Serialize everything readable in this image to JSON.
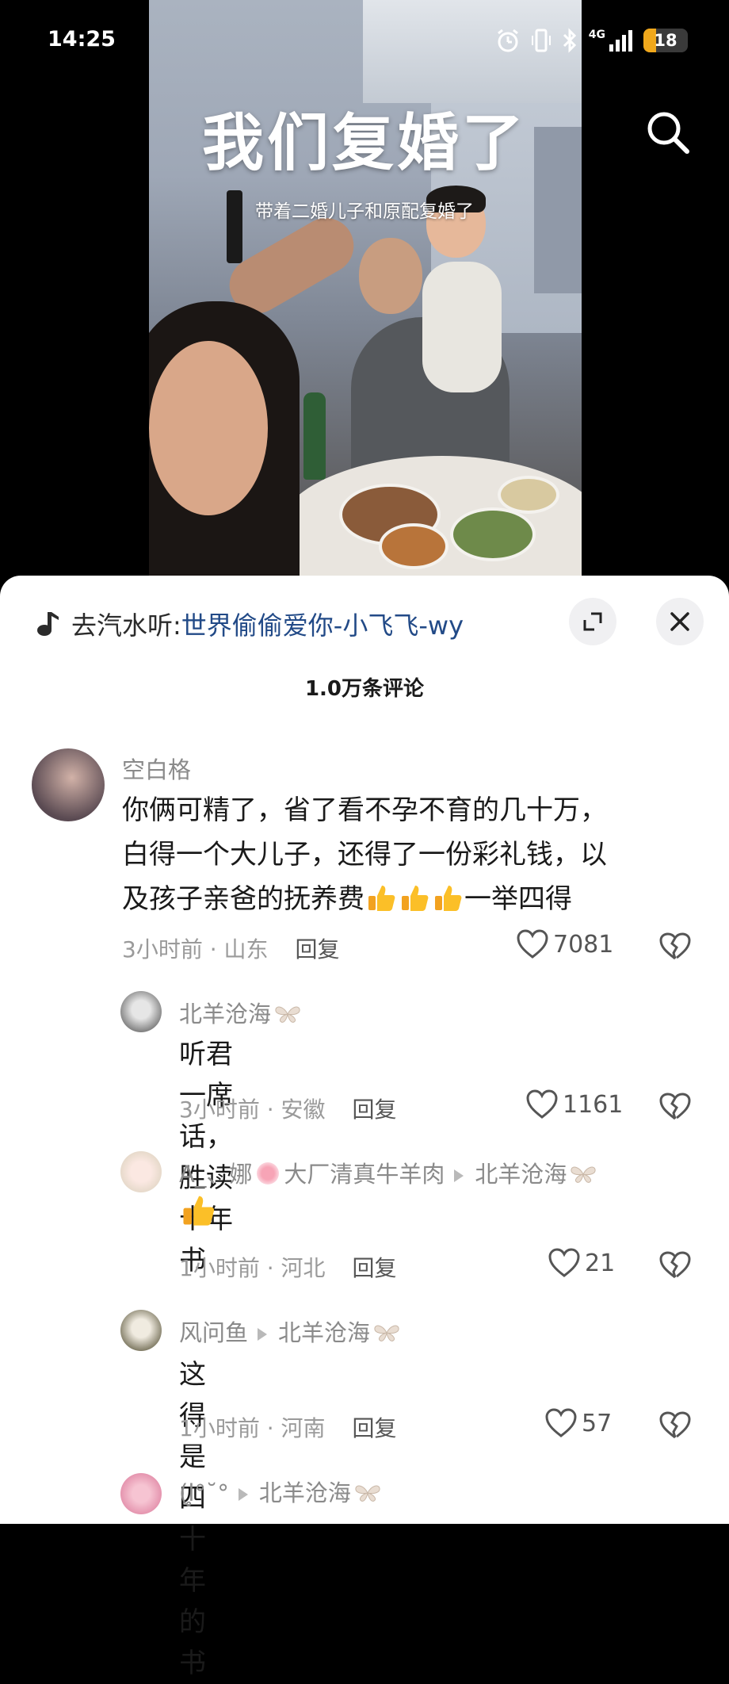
{
  "status_bar": {
    "time": "14:25",
    "network": "4G",
    "battery": "18"
  },
  "video": {
    "title": "我们复婚了",
    "subtitle": "带着二婚儿子和原配复婚了"
  },
  "music": {
    "prefix": "去汽水听: ",
    "song": "世界偷偷爱你-小飞飞-wy"
  },
  "comments_header": {
    "count": "1.0万条评论"
  },
  "comments": [
    {
      "name": "空白格",
      "lines": [
        "你俩可精了，省了看不孕不育的几十万，",
        "白得一个大儿子，还得了一份彩礼钱，以",
        "及孩子亲爸的抚养费",
        "一举四得"
      ],
      "time": "3小时前 · 山东",
      "reply_label": "回复",
      "likes": "7081"
    },
    {
      "name": "北羊沧海",
      "text": "听君一席话，胜读十年书",
      "time": "3小时前 · 安徽",
      "reply_label": "回复",
      "likes": "1161"
    },
    {
      "name": "A_、娜",
      "name_suffix": "大厂清真牛羊肉",
      "reply_to": "北羊沧海",
      "time": "1小时前 · 河北",
      "reply_label": "回复",
      "likes": "21"
    },
    {
      "name": "风问鱼",
      "reply_to": "北羊沧海",
      "text": "这得是四十年的书",
      "time": "1小时前 · 河南",
      "reply_label": "回复",
      "likes": "57"
    },
    {
      "name": "(ⅼ̥°˘°",
      "reply_to": "北羊沧海"
    }
  ],
  "colors": {
    "accent_link": "#224a87",
    "sheet_bg": "#ffffff",
    "battery": "#f0a81c"
  }
}
